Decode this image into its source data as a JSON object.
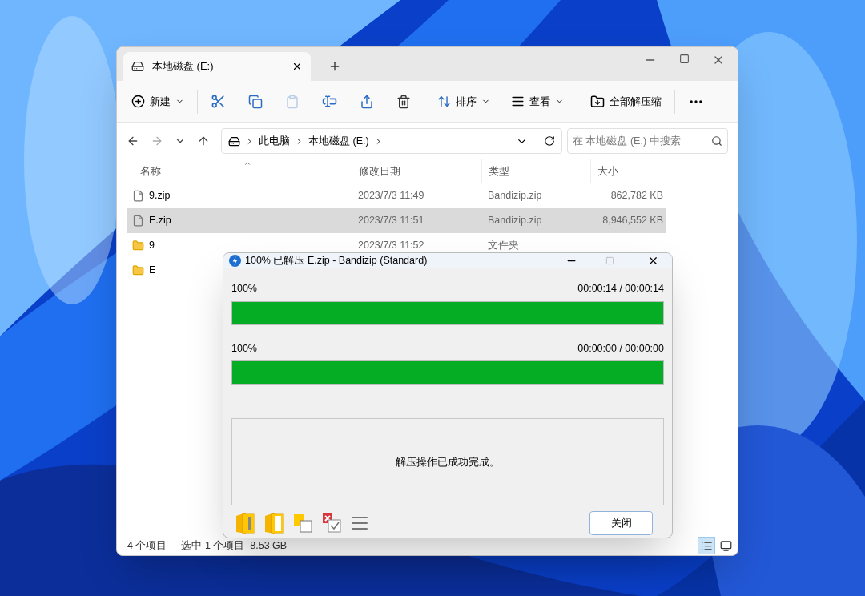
{
  "explorer": {
    "tab": {
      "title": "本地磁盘 (E:)"
    },
    "toolbar": {
      "new": "新建",
      "sort": "排序",
      "view": "查看",
      "extract_all": "全部解压缩"
    },
    "address": {
      "crumbs": [
        "此电脑",
        "本地磁盘 (E:)"
      ],
      "search_placeholder": "在 本地磁盘 (E:) 中搜索"
    },
    "columns": [
      "名称",
      "修改日期",
      "类型",
      "大小"
    ],
    "rows": [
      {
        "name": "9.zip",
        "date": "2023/7/3 11:49",
        "type": "Bandizip.zip",
        "size": "862,782 KB",
        "kind": "file",
        "selected": false
      },
      {
        "name": "E.zip",
        "date": "2023/7/3 11:51",
        "type": "Bandizip.zip",
        "size": "8,946,552 KB",
        "kind": "file",
        "selected": true
      },
      {
        "name": "9",
        "date": "2023/7/3 11:52",
        "type": "文件夹",
        "kind": "folder",
        "selected": false
      },
      {
        "name": "E",
        "kind": "folder",
        "selected": false
      }
    ],
    "status": {
      "count": "4 个项目",
      "selection": "选中 1 个项目  8.53 GB"
    },
    "views": [
      {
        "kind": "details",
        "selected": true
      },
      {
        "kind": "tiles",
        "selected": false
      }
    ]
  },
  "dialog": {
    "title": "100% 已解压 E.zip - Bandizip (Standard)",
    "progress": [
      {
        "label": "100%",
        "time": "00:00:14 / 00:00:14",
        "level": 1
      },
      {
        "label": "100%",
        "time": "00:00:00 / 00:00:00",
        "level": 1
      }
    ],
    "message": "解压操作已成功完成。",
    "close": "关闭"
  }
}
